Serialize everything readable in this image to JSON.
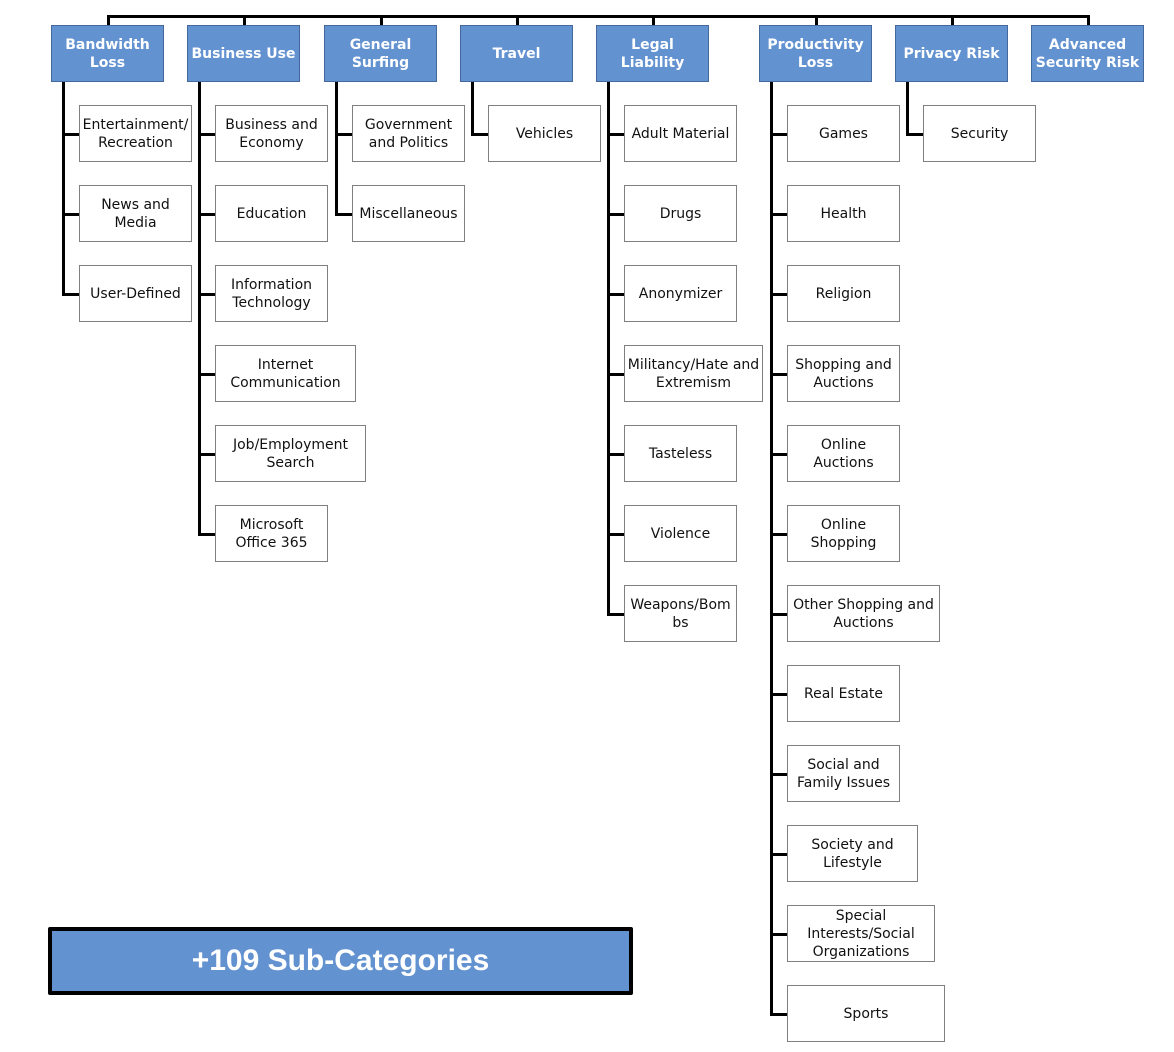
{
  "diagram": {
    "categories": [
      {
        "label": "Bandwidth Loss",
        "subs": [
          "Entertainment/ Recreation",
          "News and Media",
          "User-Defined"
        ]
      },
      {
        "label": "Business Use",
        "subs": [
          "Business and Economy",
          "Education",
          "Information Technology",
          "Internet Communication",
          "Job/Employment Search",
          "Microsoft Office 365"
        ]
      },
      {
        "label": "General Surfing",
        "subs": [
          "Government and Politics",
          "Miscellaneous"
        ]
      },
      {
        "label": "Travel",
        "subs": [
          "Vehicles"
        ]
      },
      {
        "label": "Legal Liability",
        "subs": [
          "Adult Material",
          "Drugs",
          "Anonymizer",
          "Militancy/Hate and Extremism",
          "Tasteless",
          "Violence",
          "Weapons/Bom bs"
        ]
      },
      {
        "label": "Productivity Loss",
        "subs": [
          "Games",
          "Health",
          "Religion",
          "Shopping and Auctions",
          "Online Auctions",
          "Online Shopping",
          "Other Shopping and Auctions",
          "Real Estate",
          "Social and Family Issues",
          "Society and Lifestyle",
          "Special Interests/Social Organizations",
          "Sports"
        ]
      },
      {
        "label": "Privacy Risk",
        "subs": [
          "Security"
        ]
      },
      {
        "label": "Advanced Security Risk",
        "subs": []
      }
    ],
    "more_label": "+109 Sub-Categories"
  },
  "colors": {
    "category_fill": "#6392d1",
    "category_text": "#ffffff",
    "connector": "#000000"
  }
}
